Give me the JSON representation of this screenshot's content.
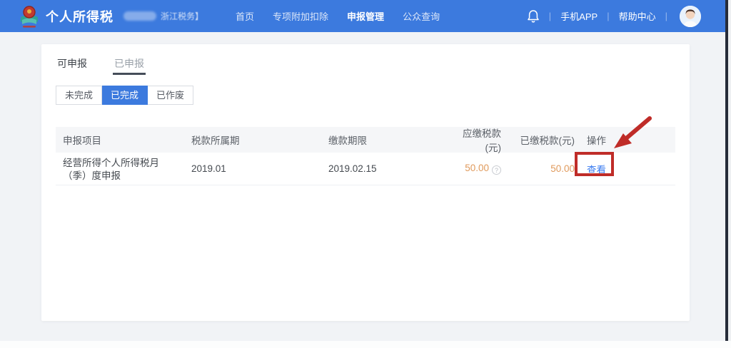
{
  "header": {
    "brand": {
      "title": "个人所得税",
      "region": "浙江税务】"
    },
    "nav": [
      {
        "label": "首页",
        "active": false
      },
      {
        "label": "专项附加扣除",
        "active": false
      },
      {
        "label": "申报管理",
        "active": true
      },
      {
        "label": "公众查询",
        "active": false
      }
    ],
    "right": {
      "app_label": "手机APP",
      "help_label": "帮助中心",
      "separator": "|"
    }
  },
  "tabs": [
    {
      "label": "可申报",
      "active": false
    },
    {
      "label": "已申报",
      "active": true
    }
  ],
  "filter_buttons": [
    {
      "label": "未完成",
      "active": false
    },
    {
      "label": "已完成",
      "active": true
    },
    {
      "label": "已作废",
      "active": false
    }
  ],
  "table": {
    "columns": [
      "申报项目",
      "税款所属期",
      "缴款期限",
      "应缴税款(元)",
      "已缴税款(元)",
      "操作"
    ],
    "rows": [
      {
        "project": "经营所得个人所得税月（季）度申报",
        "tax_period": "2019.01",
        "payment_deadline": "2019.02.15",
        "tax_payable": "50.00",
        "tax_paid": "50.00",
        "action": "查看"
      }
    ]
  },
  "icons": {
    "notification": "bell-icon",
    "tax_payable_hint": "question-circle-icon",
    "hint_glyph": "?",
    "annotation": "red-arrow-and-box"
  },
  "colors": {
    "header_blue": "#3c7ade",
    "active_button_blue": "#3c7ade",
    "link_blue": "#3b7cf0",
    "amount_orange": "#e09a5c",
    "annotation_red": "#bf2c28",
    "tab_underline": "#454d59",
    "page_background": "#f1f3f6"
  }
}
